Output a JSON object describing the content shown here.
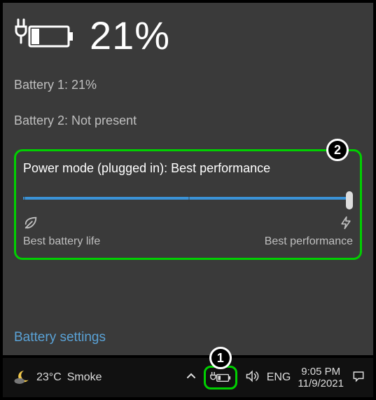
{
  "header": {
    "percent_text": "21%"
  },
  "batteries": {
    "line1": "Battery 1: 21%",
    "line2": "Battery 2: Not present"
  },
  "mode": {
    "label": "Power mode (plugged in): Best performance",
    "left_label": "Best battery life",
    "right_label": "Best performance"
  },
  "link": {
    "settings": "Battery settings"
  },
  "annotations": {
    "badge1": "1",
    "badge2": "2"
  },
  "taskbar": {
    "temp": "23°C",
    "condition": "Smoke",
    "lang": "ENG",
    "time": "9:05 PM",
    "date": "11/9/2021"
  }
}
